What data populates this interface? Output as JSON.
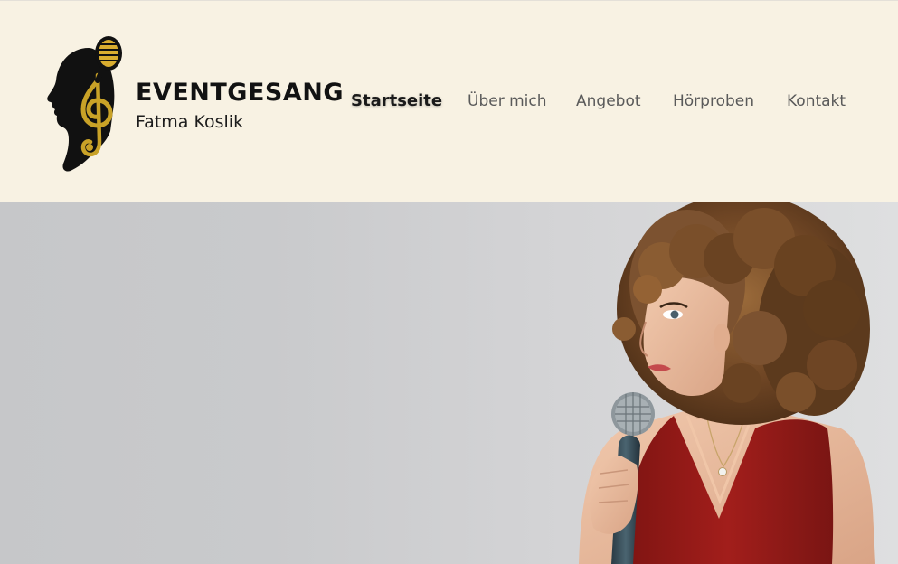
{
  "brand": {
    "title": "EVENTGESANG",
    "subtitle": "Fatma Koslik",
    "logo_icon": "singer-profile-treble-clef-microphone-icon"
  },
  "nav": {
    "items": [
      {
        "label": "Startseite",
        "active": true
      },
      {
        "label": "Über mich",
        "active": false
      },
      {
        "label": "Angebot",
        "active": false
      },
      {
        "label": "Hörproben",
        "active": false
      },
      {
        "label": "Kontakt",
        "active": false
      }
    ]
  },
  "hero": {
    "image": "singer-with-microphone-photo"
  },
  "colors": {
    "header_bg": "#f8f2e3",
    "logo_gold": "#c9a227",
    "text_dark": "#121212",
    "nav_text": "#5a5a5a",
    "dress_red": "#9a1c1a",
    "wall_gray": "#cfd0d2"
  }
}
